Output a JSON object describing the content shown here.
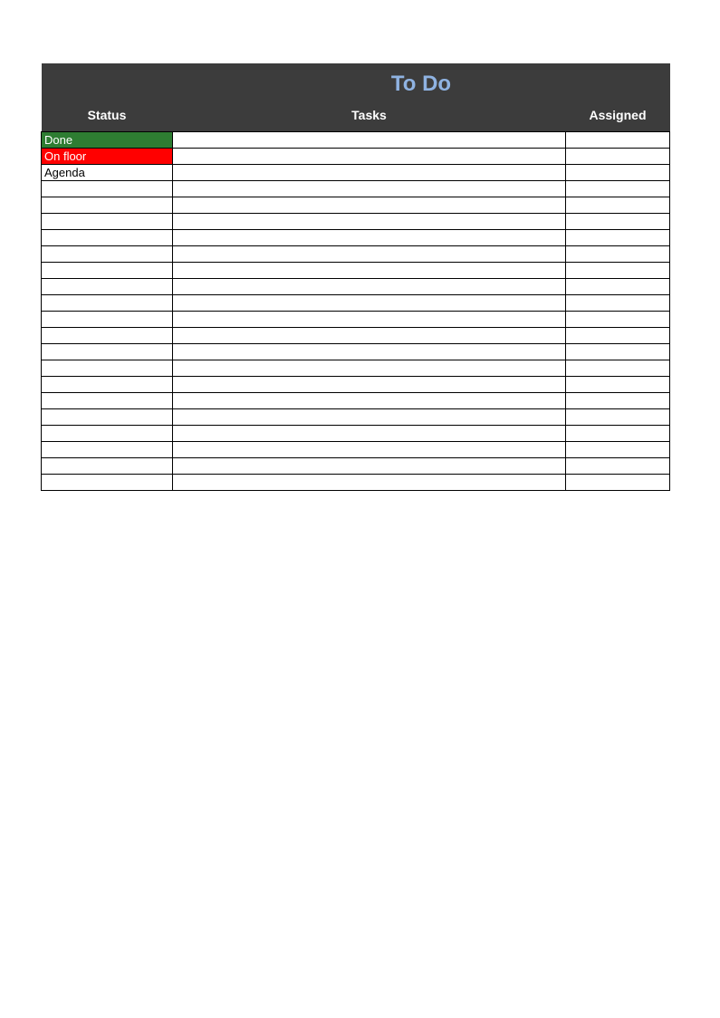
{
  "title": "To Do",
  "columns": {
    "status": "Status",
    "tasks": "Tasks",
    "assigned": "Assigned"
  },
  "status_colors": {
    "Done": {
      "bg": "#2e7d32",
      "fg": "#ffffff"
    },
    "On floor": {
      "bg": "#ff0000",
      "fg": "#ffffff"
    },
    "Agenda": {
      "bg": "#ffffff",
      "fg": "#000000"
    }
  },
  "rows": [
    {
      "status": "Done",
      "tasks": "",
      "assigned": ""
    },
    {
      "status": "On floor",
      "tasks": "",
      "assigned": ""
    },
    {
      "status": "Agenda",
      "tasks": "",
      "assigned": ""
    },
    {
      "status": "",
      "tasks": "",
      "assigned": ""
    },
    {
      "status": "",
      "tasks": "",
      "assigned": ""
    },
    {
      "status": "",
      "tasks": "",
      "assigned": ""
    },
    {
      "status": "",
      "tasks": "",
      "assigned": ""
    },
    {
      "status": "",
      "tasks": "",
      "assigned": ""
    },
    {
      "status": "",
      "tasks": "",
      "assigned": ""
    },
    {
      "status": "",
      "tasks": "",
      "assigned": ""
    },
    {
      "status": "",
      "tasks": "",
      "assigned": ""
    },
    {
      "status": "",
      "tasks": "",
      "assigned": ""
    },
    {
      "status": "",
      "tasks": "",
      "assigned": ""
    },
    {
      "status": "",
      "tasks": "",
      "assigned": ""
    },
    {
      "status": "",
      "tasks": "",
      "assigned": ""
    },
    {
      "status": "",
      "tasks": "",
      "assigned": ""
    },
    {
      "status": "",
      "tasks": "",
      "assigned": ""
    },
    {
      "status": "",
      "tasks": "",
      "assigned": ""
    },
    {
      "status": "",
      "tasks": "",
      "assigned": ""
    },
    {
      "status": "",
      "tasks": "",
      "assigned": ""
    },
    {
      "status": "",
      "tasks": "",
      "assigned": ""
    },
    {
      "status": "",
      "tasks": "",
      "assigned": ""
    }
  ]
}
